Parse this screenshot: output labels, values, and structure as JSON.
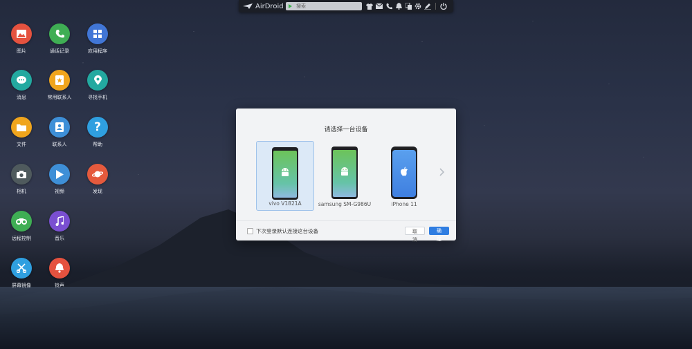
{
  "topbar": {
    "logo_text": "AirDroid",
    "search_placeholder": "搜索",
    "icons": [
      "tshirt-icon",
      "mail-icon",
      "phone-icon",
      "bell-icon",
      "copy-icon",
      "gear-icon",
      "pen-icon",
      "power-icon"
    ]
  },
  "desktop": {
    "icons": [
      {
        "label": "图片",
        "color": "#e5523f",
        "icon": "picture-icon"
      },
      {
        "label": "通话记录",
        "color": "#3fae54",
        "icon": "call-log-icon"
      },
      {
        "label": "应用程序",
        "color": "#4176d6",
        "icon": "apps-icon"
      },
      {
        "label": "消息",
        "color": "#23a9a0",
        "icon": "message-icon"
      },
      {
        "label": "常用联系人",
        "color": "#f0a51d",
        "icon": "favorite-contacts-icon"
      },
      {
        "label": "寻找手机",
        "color": "#23a9a0",
        "icon": "find-phone-icon"
      },
      {
        "label": "文件",
        "color": "#f0a51d",
        "icon": "folder-icon"
      },
      {
        "label": "联系人",
        "color": "#3e8fd7",
        "icon": "contacts-icon"
      },
      {
        "label": "帮助",
        "color": "#2f9fe0",
        "icon": "help-icon"
      },
      {
        "label": "相机",
        "color": "#4f5a5d",
        "icon": "camera-icon"
      },
      {
        "label": "视频",
        "color": "#3e8fd7",
        "icon": "video-icon"
      },
      {
        "label": "发现",
        "color": "#e55a3d",
        "icon": "discover-icon"
      },
      {
        "label": "远程控制",
        "color": "#3fae54",
        "icon": "remote-control-icon"
      },
      {
        "label": "音乐",
        "color": "#7a4fd1",
        "icon": "music-icon"
      },
      {
        "label": "屏幕镜像",
        "color": "#2f9fe0",
        "icon": "screen-mirror-icon"
      },
      {
        "label": "铃声",
        "color": "#e5523f",
        "icon": "ringtone-icon"
      }
    ]
  },
  "dialog": {
    "title": "请选择一台设备",
    "devices": [
      {
        "name": "vivo V1821A",
        "type": "android",
        "selected": true
      },
      {
        "name": "samsung SM-G986U",
        "type": "android",
        "selected": false
      },
      {
        "name": "iPhone 11",
        "type": "ios",
        "selected": false
      }
    ],
    "checkbox_label": "下次登录默认连接这台设备",
    "checkbox_checked": false,
    "cancel_label": "取消",
    "ok_label": "确定"
  }
}
